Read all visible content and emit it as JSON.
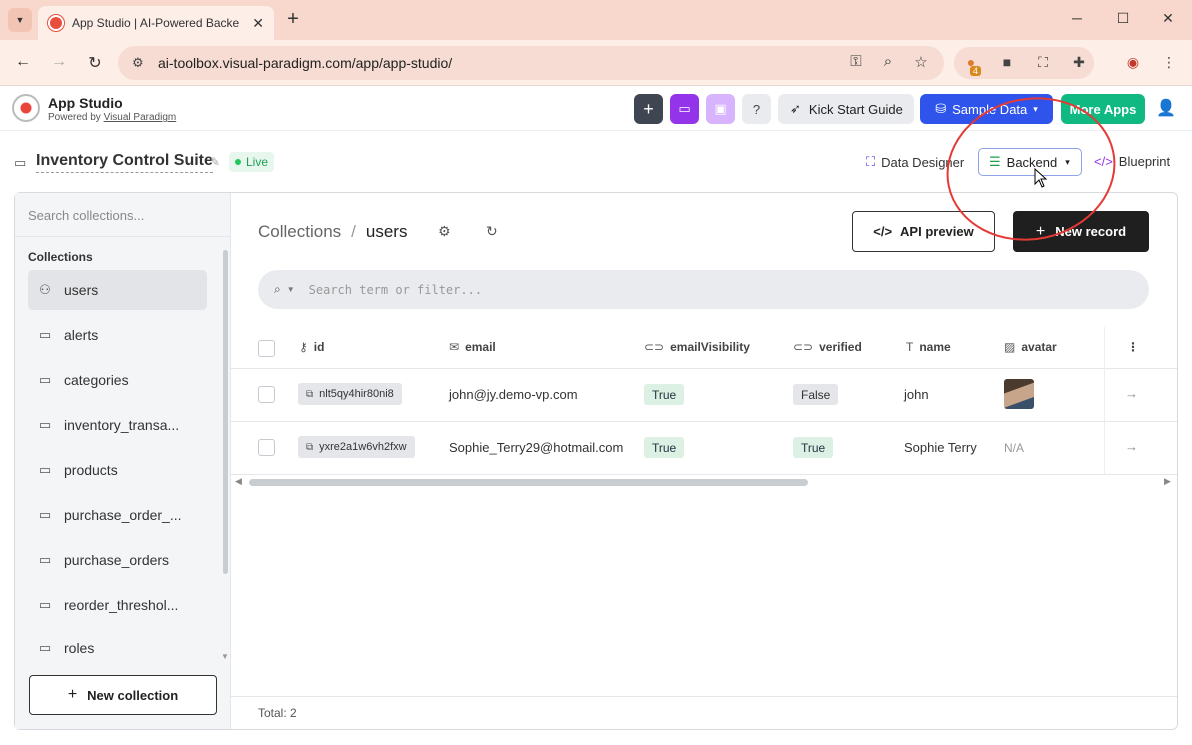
{
  "browser": {
    "tab_title": "App Studio | AI-Powered Backe",
    "url": "ai-toolbox.visual-paradigm.com/app/app-studio/",
    "extension_badge": "4"
  },
  "header": {
    "brand_title": "App Studio",
    "brand_powered": "Powered by ",
    "brand_link": "Visual Paradigm",
    "kick_start": "Kick Start Guide",
    "sample_data": "Sample Data",
    "more_apps": "More Apps",
    "colors": {
      "plus_btn": "#3f4652",
      "folder_btn": "#9333ea",
      "save_btn": "#d8b4fe",
      "sample": "#2f54eb",
      "more": "#10b981"
    }
  },
  "project": {
    "title": "Inventory Control Suite",
    "status": "Live",
    "data_designer": "Data Designer",
    "backend": "Backend",
    "blueprint": "Blueprint"
  },
  "sidebar": {
    "search_placeholder": "Search collections...",
    "heading": "Collections",
    "items": [
      {
        "label": "users",
        "icon": "users-icon"
      },
      {
        "label": "alerts",
        "icon": "folder-icon"
      },
      {
        "label": "categories",
        "icon": "folder-icon"
      },
      {
        "label": "inventory_transa...",
        "icon": "folder-icon"
      },
      {
        "label": "products",
        "icon": "folder-icon"
      },
      {
        "label": "purchase_order_...",
        "icon": "folder-icon"
      },
      {
        "label": "purchase_orders",
        "icon": "folder-icon"
      },
      {
        "label": "reorder_threshol...",
        "icon": "folder-icon"
      },
      {
        "label": "roles",
        "icon": "folder-icon"
      }
    ],
    "new_collection": "New collection"
  },
  "main": {
    "breadcrumb_root": "Collections",
    "breadcrumb_sep": "/",
    "breadcrumb_current": "users",
    "api_preview": "API preview",
    "new_record": "New record",
    "filter_placeholder": "Search term or filter...",
    "columns": [
      "id",
      "email",
      "emailVisibility",
      "verified",
      "name",
      "avatar"
    ],
    "rows": [
      {
        "id": "nlt5qy4hir80ni8",
        "email": "john@jy.demo-vp.com",
        "emailVisibility": "True",
        "verified": "False",
        "name": "john",
        "avatar": ""
      },
      {
        "id": "yxre2a1w6vh2fxw",
        "email": "Sophie_Terry29@hotmail.com",
        "emailVisibility": "True",
        "verified": "True",
        "name": "Sophie Terry",
        "avatar": "N/A"
      }
    ],
    "total": "Total: 2"
  }
}
